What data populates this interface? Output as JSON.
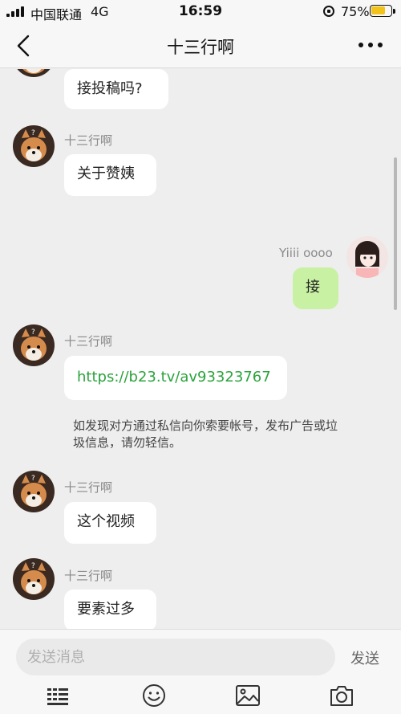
{
  "status_bar": {
    "carrier": "中国联通",
    "network": "4G",
    "time": "16:59",
    "battery_percent": "75%",
    "battery_level": 0.75
  },
  "nav": {
    "title": "十三行啊",
    "back_icon": "chevron-left-icon",
    "more_icon": "ellipsis-icon"
  },
  "messages": [
    {
      "from": "other",
      "show_name": false,
      "text": "接投稿吗?"
    },
    {
      "from": "other",
      "sender": "十三行啊",
      "text": "关于赞姨"
    },
    {
      "from": "me",
      "sender": "Yiiii oooo",
      "text": "接"
    },
    {
      "from": "other",
      "sender": "十三行啊",
      "text": "https://b23.tv/av93323767",
      "is_link": true
    },
    {
      "from": "system",
      "text": "如发现对方通过私信向你索要帐号，发布广告或垃圾信息，请勿轻信。"
    },
    {
      "from": "other",
      "sender": "十三行啊",
      "text": "这个视频"
    },
    {
      "from": "other",
      "sender": "十三行啊",
      "text": "要素过多"
    }
  ],
  "input": {
    "placeholder": "发送消息",
    "send_label": "发送"
  },
  "toolbar": {
    "icons": [
      "keyboard-icon",
      "emoji-icon",
      "image-icon",
      "camera-icon"
    ]
  },
  "colors": {
    "my_bubble": "#c8f1a3",
    "link": "#2aa33c",
    "background": "#eeeeee"
  }
}
